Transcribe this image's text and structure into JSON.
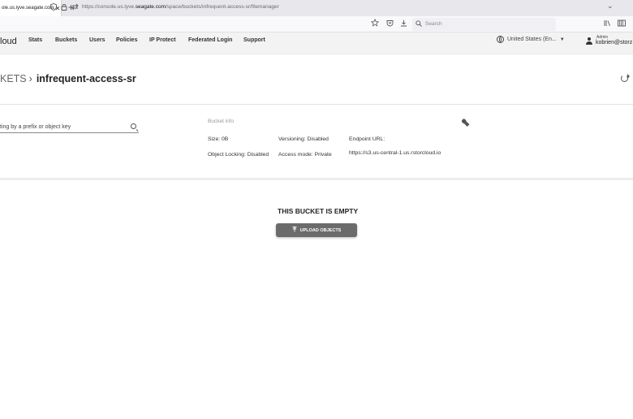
{
  "browser": {
    "tab_title": "ole.us.lyve.seagate.com/sp",
    "tab_close": "✕",
    "new_tab": "+",
    "tabs_menu": "⌄",
    "url_prefix": "https://console.us.lyve.",
    "url_domain": "seagate.com",
    "url_path": "/space/buckets/infrequent-access-sr/filemanager",
    "search_placeholder": "Search"
  },
  "header": {
    "brand": "loud",
    "menu": [
      "Stats",
      "Buckets",
      "Users",
      "Policies",
      "IP Protect",
      "Federated Login",
      "Support"
    ],
    "region": "United States (En...",
    "user_role": "Admin",
    "user_name": "kobrien@storz"
  },
  "breadcrumb": {
    "parent": "KETS",
    "separator": "›",
    "current": "infrequent-access-sr"
  },
  "filter": {
    "placeholder": "ting by a prefix or object key"
  },
  "bucket_info": {
    "title": "Bucket info",
    "size": "Size: 0B",
    "versioning": "Versioning: Disabled",
    "endpoint_label": "Endpoint URL:",
    "object_locking": "Object Locking: Disabled",
    "access_mode": "Access mode: Private",
    "endpoint_url": "https://s3.us-central-1.us.rstorcloud.io"
  },
  "empty_state": {
    "title": "THIS BUCKET IS EMPTY",
    "upload_label": "UPLOAD OBJECTS"
  }
}
